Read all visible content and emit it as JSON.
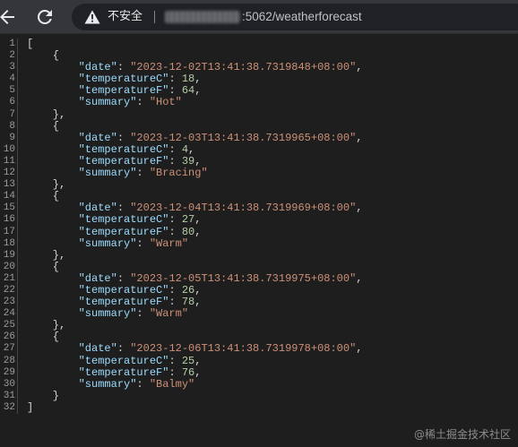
{
  "toolbar": {
    "security_label": "不安全",
    "url_path": ":5062/weatherforecast"
  },
  "icons": {
    "back": "back-arrow-icon",
    "reload": "reload-icon",
    "warning": "warning-triangle-icon"
  },
  "colors": {
    "key": "#9cdcfe",
    "string": "#ce9178",
    "number": "#b5cea8",
    "punct": "#d4d4d4",
    "background": "#1e1e1e"
  },
  "records": [
    {
      "date": "2023-12-02T13:41:38.7319848+08:00",
      "temperatureC": 18,
      "temperatureF": 64,
      "summary": "Hot"
    },
    {
      "date": "2023-12-03T13:41:38.7319965+08:00",
      "temperatureC": 4,
      "temperatureF": 39,
      "summary": "Bracing"
    },
    {
      "date": "2023-12-04T13:41:38.7319969+08:00",
      "temperatureC": 27,
      "temperatureF": 80,
      "summary": "Warm"
    },
    {
      "date": "2023-12-05T13:41:38.7319975+08:00",
      "temperatureC": 26,
      "temperatureF": 78,
      "summary": "Warm"
    },
    {
      "date": "2023-12-06T13:41:38.7319978+08:00",
      "temperatureC": 25,
      "temperatureF": 76,
      "summary": "Balmy"
    }
  ],
  "watermark": "@稀土掘金技术社区"
}
